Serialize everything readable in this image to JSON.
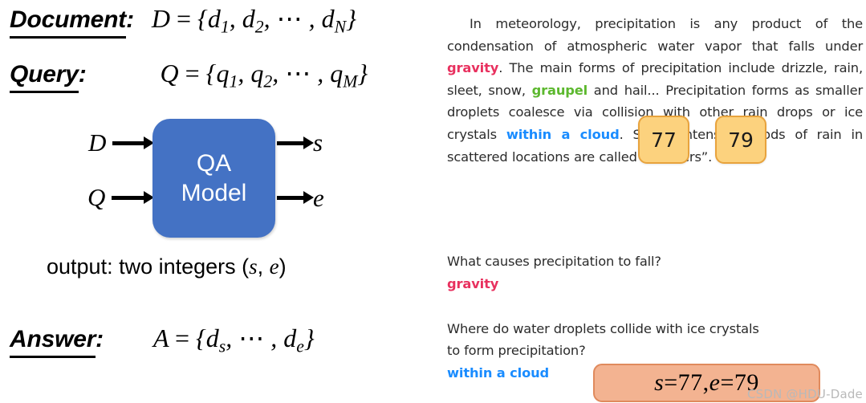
{
  "left": {
    "document": {
      "label": "Document",
      "colon": ":",
      "math_lhs": "D",
      "eq": "=",
      "math_rhs_open": "{",
      "math_items": "d₁, d₂, ⋯ , dₙ",
      "math_rhs_close": "}",
      "formula": "D = {d₁, d₂, ⋯ , d_N}"
    },
    "query": {
      "label": "Query",
      "colon": ":",
      "formula": "Q = {q₁, q₂, ⋯ , q_M}"
    },
    "answer": {
      "label": "Answer",
      "colon": ":",
      "formula": "A = {d_s, ⋯ , d_e}"
    },
    "diagram": {
      "input_document_symbol": "D",
      "input_query_symbol": "Q",
      "model_line1": "QA",
      "model_line2": "Model",
      "output_start_symbol": "s",
      "output_end_symbol": "e",
      "box_color": "#4472C4"
    },
    "output_caption": {
      "prefix": "output: two integers (",
      "start": "s",
      "comma": ", ",
      "end": "e",
      "suffix": ")"
    }
  },
  "right": {
    "passage": {
      "p1": "In meteorology, precipitation is any product of the condensation of atmospheric water vapor that falls under ",
      "highlight_gravity": "gravity",
      "p2": ". The main forms of precipitation include drizzle, rain, sleet, snow, ",
      "highlight_graupel": "graupel",
      "p3": " and hail... Precipitation forms as smaller droplets coalesce via collision with other rain drops or ice crystals ",
      "highlight_cloud": "within a cloud",
      "p4": ". Short, intense periods of rain in scattered locations are called “showers”."
    },
    "chips": {
      "start_index": "77",
      "end_index": "79",
      "fill_color": "#FCD27E",
      "border_color": "#E8A33D"
    },
    "qa": [
      {
        "question": "What causes precipitation to fall?",
        "answer": "gravity",
        "answer_color": "#E8315F"
      },
      {
        "question_line1": "Where do water droplets collide with ice crystals",
        "question_line2": "to form precipitation?",
        "answer": "within a cloud",
        "answer_color": "#1A8CFF"
      }
    ],
    "span_result": {
      "s_symbol": "s",
      "eq1": " = ",
      "s_value": "77",
      "separator": ", ",
      "e_symbol": "e",
      "eq2": " = ",
      "e_value": "79",
      "fill_color": "#F3B391"
    }
  },
  "watermark": "CSDN @HDU-Dade"
}
